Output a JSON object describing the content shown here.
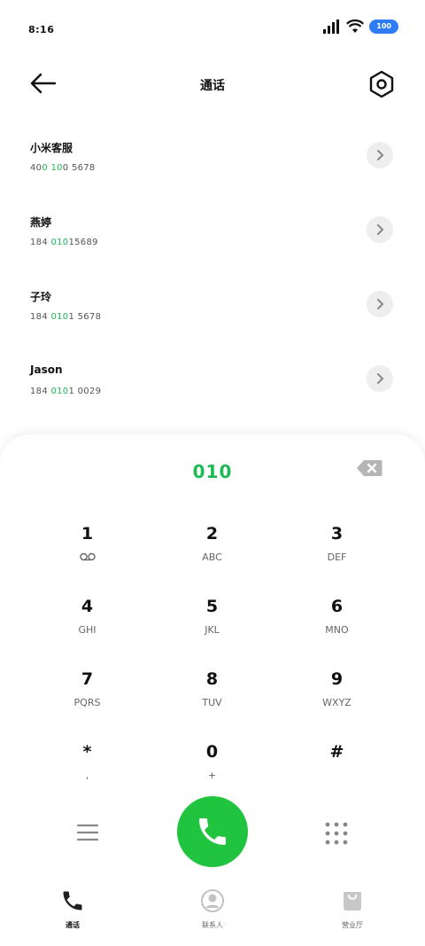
{
  "status": {
    "time": "8:16",
    "battery": "100"
  },
  "header": {
    "title": "通话"
  },
  "contacts": [
    {
      "name": "小米客服",
      "num_pre": "40",
      "num_hl": "0 10",
      "num_post": "0 5678"
    },
    {
      "name": "燕婷",
      "num_pre": "184 ",
      "num_hl": "010",
      "num_post": "15689"
    },
    {
      "name": "子玲",
      "num_pre": "184 ",
      "num_hl": "010",
      "num_post": "1 5678"
    },
    {
      "name": "Jason",
      "num_pre": "184 ",
      "num_hl": "010",
      "num_post": "1 0029"
    }
  ],
  "dialer": {
    "number": "010",
    "keys": [
      {
        "digit": "1",
        "letters": ""
      },
      {
        "digit": "2",
        "letters": "ABC"
      },
      {
        "digit": "3",
        "letters": "DEF"
      },
      {
        "digit": "4",
        "letters": "GHI"
      },
      {
        "digit": "5",
        "letters": "JKL"
      },
      {
        "digit": "6",
        "letters": "MNO"
      },
      {
        "digit": "7",
        "letters": "PQRS"
      },
      {
        "digit": "8",
        "letters": "TUV"
      },
      {
        "digit": "9",
        "letters": "WXYZ"
      },
      {
        "digit": "*",
        "letters": ","
      },
      {
        "digit": "0",
        "letters": "+"
      },
      {
        "digit": "#",
        "letters": ""
      }
    ]
  },
  "tabs": [
    {
      "label": "通话",
      "icon": "phone-icon",
      "active": true
    },
    {
      "label": "联系人",
      "icon": "person-icon",
      "active": false
    },
    {
      "label": "营业厅",
      "icon": "bag-icon",
      "active": false
    }
  ],
  "colors": {
    "accent": "#1db954",
    "call": "#20c43e",
    "battery": "#2f7df6"
  }
}
